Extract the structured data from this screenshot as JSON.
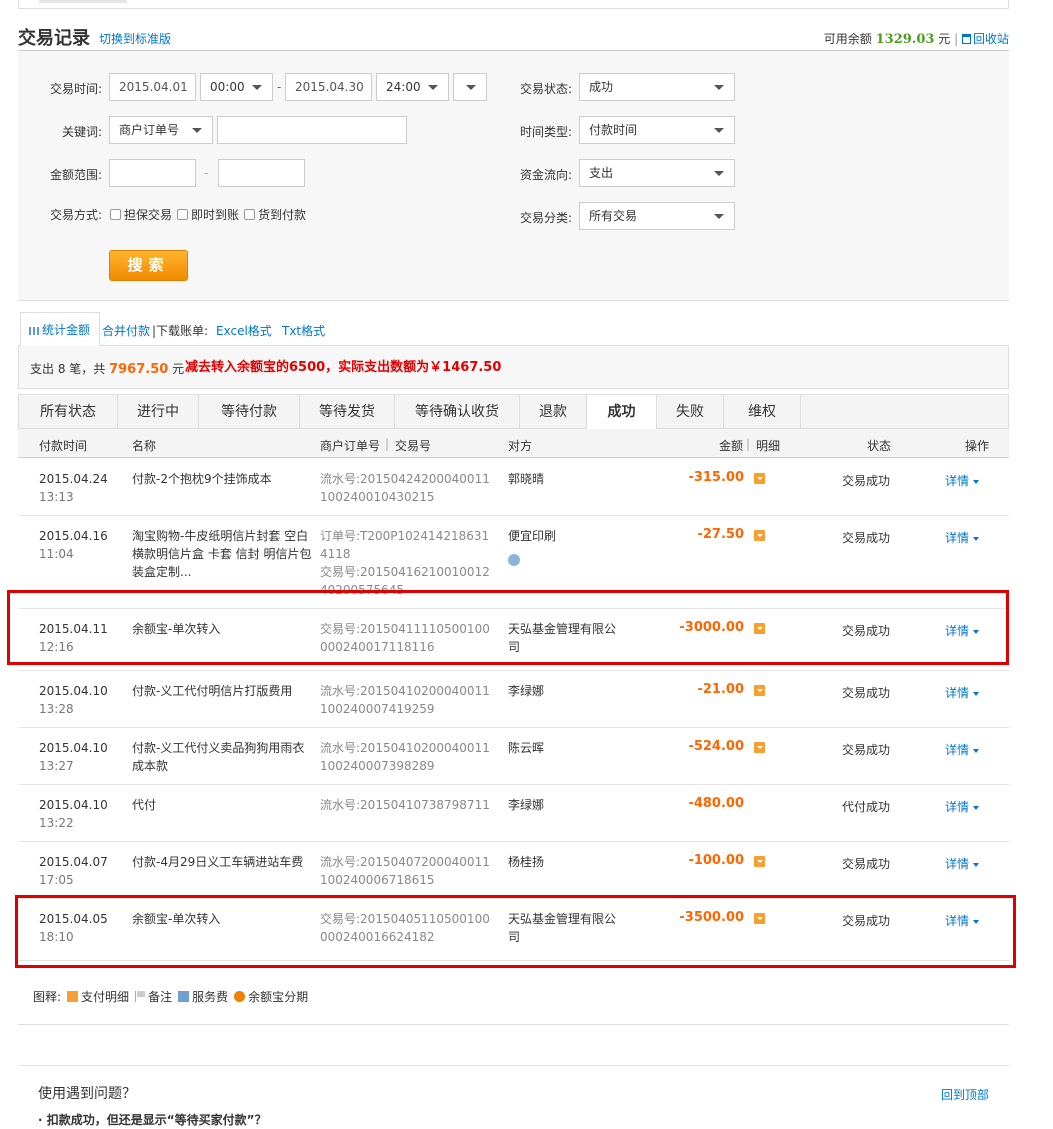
{
  "header": {
    "title": "交易记录",
    "switch_link": "切换到标准版",
    "balance_label": "可用余额",
    "balance_amount": "1329.03",
    "balance_unit": "元",
    "separator": "|",
    "recycle_link": "回收站"
  },
  "filters": {
    "time_label": "交易时间:",
    "start_date": "2015.04.01",
    "start_time": "00:00",
    "dash": "-",
    "end_date": "2015.04.30",
    "end_time": "24:00",
    "status_label": "交易状态:",
    "status_value": "成功",
    "keyword_label": "关键词:",
    "keyword_type": "商户订单号",
    "keyword_value": "",
    "time_type_label": "时间类型:",
    "time_type_value": "付款时间",
    "amount_label": "金额范围:",
    "amount_min": "",
    "amount_max": "",
    "flow_label": "资金流向:",
    "flow_value": "支出",
    "method_label": "交易方式:",
    "methods": [
      "担保交易",
      "即时到账",
      "货到付款"
    ],
    "category_label": "交易分类:",
    "category_value": "所有交易",
    "search_button": "搜索"
  },
  "tools": {
    "stats_tab": "统计金额",
    "merge_pay": "合并付款",
    "download_label": "|下载账单:",
    "excel": "Excel格式",
    "txt": "Txt格式"
  },
  "summary": {
    "prefix": "支出 8 笔，共",
    "total": "7967.50",
    "unit": "元",
    "note": "减去转入余额宝的6500，实际支出数额为￥1467.50"
  },
  "status_tabs": [
    "所有状态",
    "进行中",
    "等待付款",
    "等待发货",
    "等待确认收货",
    "退款",
    "成功",
    "失败",
    "维权"
  ],
  "active_status_tab": "成功",
  "table": {
    "headers": {
      "time": "付款时间",
      "name": "名称",
      "order": "商户订单号",
      "sep": "|",
      "trade": "交易号",
      "party": "对方",
      "amount": "金额",
      "detail": "明细",
      "status": "状态",
      "op": "操作"
    },
    "rows": [
      {
        "date": "2015.04.24",
        "time": "13:13",
        "name": "付款-2个抱枕9个挂饰成本",
        "number": "流水号:20150424200040011100240010430215",
        "party": "郭晓晴",
        "amount": "-315.00",
        "status": "交易成功",
        "op": "详情"
      },
      {
        "date": "2015.04.16",
        "time": "11:04",
        "name": "淘宝购物-牛皮纸明信片封套 空白横款明信片盒 卡套 信封 明信片包装盒定制...",
        "number": "订单号:T200P1024142186314118",
        "number2": "交易号:2015041621001001240200575645",
        "party": "便宜印刷",
        "amount": "-27.50",
        "status": "交易成功",
        "op": "详情"
      },
      {
        "date": "2015.04.11",
        "time": "12:16",
        "name": "余额宝-单次转入",
        "number": "交易号:20150411110500100000240017118116",
        "party": "天弘基金管理有限公司",
        "amount": "-3000.00",
        "status": "交易成功",
        "op": "详情"
      },
      {
        "date": "2015.04.10",
        "time": "13:28",
        "name": "付款-义工代付明信片打版费用",
        "number": "流水号:20150410200040011100240007419259",
        "party": "李绿娜",
        "amount": "-21.00",
        "status": "交易成功",
        "op": "详情"
      },
      {
        "date": "2015.04.10",
        "time": "13:27",
        "name": "付款-义工代付义卖品狗狗用雨衣成本款",
        "number": "流水号:20150410200040011100240007398289",
        "party": "陈云晖",
        "amount": "-524.00",
        "status": "交易成功",
        "op": "详情"
      },
      {
        "date": "2015.04.10",
        "time": "13:22",
        "name": "代付",
        "number": "流水号:20150410738798711",
        "party": "李绿娜",
        "amount": "-480.00",
        "status": "代付成功",
        "op": "详情"
      },
      {
        "date": "2015.04.07",
        "time": "17:05",
        "name": "付款-4月29日义工车辆进站车费",
        "number": "流水号:20150407200040011100240006718615",
        "party": "杨桂扬",
        "amount": "-100.00",
        "status": "交易成功",
        "op": "详情"
      },
      {
        "date": "2015.04.05",
        "time": "18:10",
        "name": "余额宝-单次转入",
        "number": "交易号:20150405110500100000240016624182",
        "party": "天弘基金管理有限公司",
        "amount": "-3500.00",
        "status": "交易成功",
        "op": "详情"
      }
    ]
  },
  "legend": {
    "label": "图释:",
    "items": [
      "支付明细",
      "备注",
      "服务费",
      "余额宝分期"
    ]
  },
  "help": {
    "title": "使用遇到问题？",
    "back_top": "回到顶部",
    "q1": "· 扣款成功，但还是显示“等待买家付款”？"
  },
  "colors": {
    "link": "#0077cc",
    "amount": "#ff6600",
    "balance": "#4a9e1b",
    "highlight": "#e00000"
  }
}
